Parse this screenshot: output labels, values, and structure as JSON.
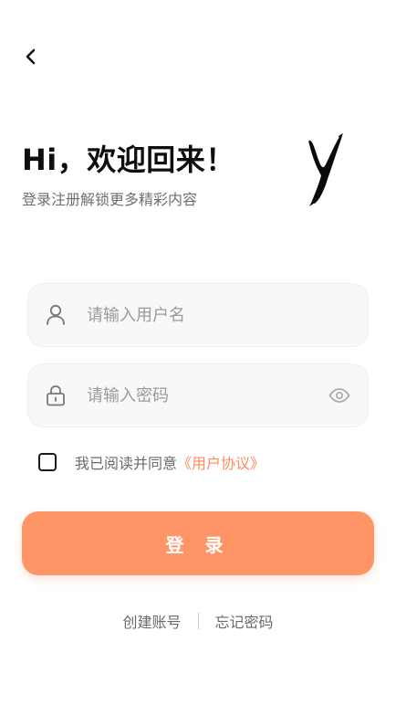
{
  "header": {
    "back_icon": "chevron-left-icon",
    "title": "Hi，欢迎回来！",
    "subtitle": "登录注册解锁更多精彩内容"
  },
  "form": {
    "username": {
      "icon": "user-icon",
      "placeholder": "请输入用户名",
      "value": ""
    },
    "password": {
      "icon": "lock-icon",
      "placeholder": "请输入密码",
      "value": "",
      "visibility_icon": "eye-icon"
    },
    "agreement": {
      "checked": false,
      "text": "我已阅读并同意",
      "link": "《用户协议》"
    },
    "login_label": "登 录"
  },
  "footer": {
    "create_account": "创建账号",
    "forgot_password": "忘记密码"
  },
  "colors": {
    "accent": "#ff9466",
    "link": "#ff8a5c",
    "field_bg": "#f8f8f8"
  }
}
